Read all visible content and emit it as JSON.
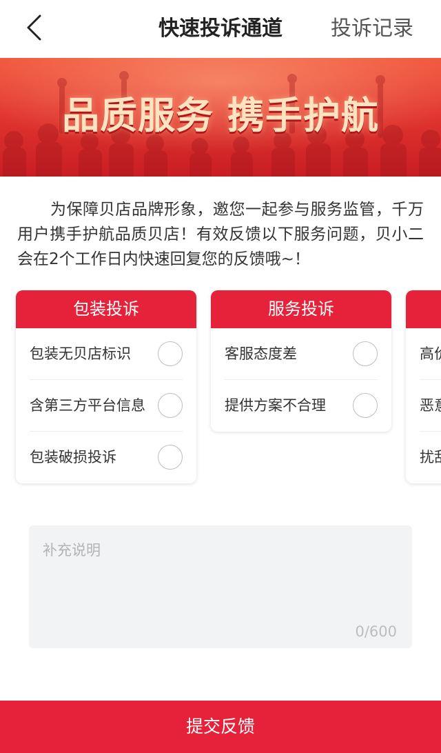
{
  "nav": {
    "title": "快速投诉通道",
    "right_link": "投诉记录",
    "back_icon": "chevron-left-icon"
  },
  "banner": {
    "slogan": "品质服务 携手护航"
  },
  "intro": {
    "text": "为保障贝店品牌形象，邀您一起参与服务监管，千万用户携手护航品质贝店！有效反馈以下服务问题，贝小二会在2个工作日内快速回复您的反馈哦~！"
  },
  "categories": [
    {
      "title": "包装投诉",
      "items": [
        "包装无贝店标识",
        "含第三方平台信息",
        "包装破损投诉"
      ]
    },
    {
      "title": "服务投诉",
      "items": [
        "客服态度差",
        "提供方案不合理"
      ]
    },
    {
      "title": "",
      "items": [
        "高价",
        "恶意",
        "扰乱"
      ]
    }
  ],
  "note": {
    "placeholder": "补充说明",
    "counter": "0/600"
  },
  "submit": {
    "label": "提交反馈"
  },
  "colors": {
    "accent": "#e5223a",
    "banner_text": "#fde3bf",
    "note_bg": "#f2f3f5"
  }
}
